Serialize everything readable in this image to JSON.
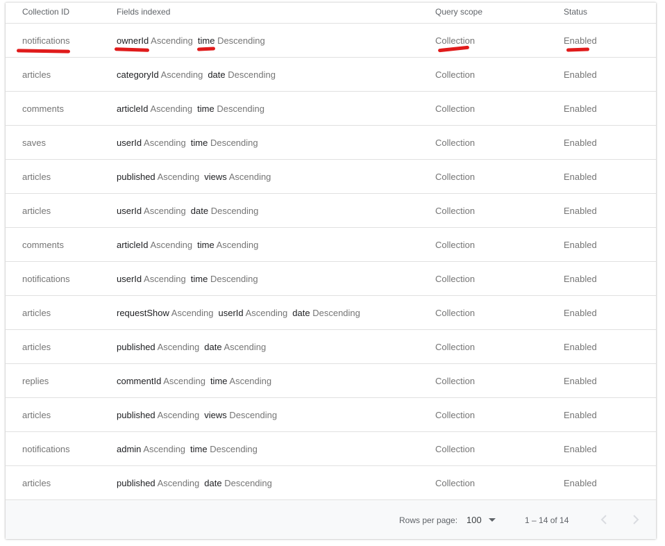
{
  "table": {
    "headers": {
      "collection_id": "Collection ID",
      "fields_indexed": "Fields indexed",
      "query_scope": "Query scope",
      "status": "Status"
    },
    "rows": [
      {
        "collection": "notifications",
        "fields": [
          {
            "name": "ownerId",
            "order": "Ascending"
          },
          {
            "name": "time",
            "order": "Descending"
          }
        ],
        "scope": "Collection",
        "status": "Enabled"
      },
      {
        "collection": "articles",
        "fields": [
          {
            "name": "categoryId",
            "order": "Ascending"
          },
          {
            "name": "date",
            "order": "Descending"
          }
        ],
        "scope": "Collection",
        "status": "Enabled"
      },
      {
        "collection": "comments",
        "fields": [
          {
            "name": "articleId",
            "order": "Ascending"
          },
          {
            "name": "time",
            "order": "Descending"
          }
        ],
        "scope": "Collection",
        "status": "Enabled"
      },
      {
        "collection": "saves",
        "fields": [
          {
            "name": "userId",
            "order": "Ascending"
          },
          {
            "name": "time",
            "order": "Descending"
          }
        ],
        "scope": "Collection",
        "status": "Enabled"
      },
      {
        "collection": "articles",
        "fields": [
          {
            "name": "published",
            "order": "Ascending"
          },
          {
            "name": "views",
            "order": "Ascending"
          }
        ],
        "scope": "Collection",
        "status": "Enabled"
      },
      {
        "collection": "articles",
        "fields": [
          {
            "name": "userId",
            "order": "Ascending"
          },
          {
            "name": "date",
            "order": "Descending"
          }
        ],
        "scope": "Collection",
        "status": "Enabled"
      },
      {
        "collection": "comments",
        "fields": [
          {
            "name": "articleId",
            "order": "Ascending"
          },
          {
            "name": "time",
            "order": "Ascending"
          }
        ],
        "scope": "Collection",
        "status": "Enabled"
      },
      {
        "collection": "notifications",
        "fields": [
          {
            "name": "userId",
            "order": "Ascending"
          },
          {
            "name": "time",
            "order": "Descending"
          }
        ],
        "scope": "Collection",
        "status": "Enabled"
      },
      {
        "collection": "articles",
        "fields": [
          {
            "name": "requestShow",
            "order": "Ascending"
          },
          {
            "name": "userId",
            "order": "Ascending"
          },
          {
            "name": "date",
            "order": "Descending"
          }
        ],
        "scope": "Collection",
        "status": "Enabled"
      },
      {
        "collection": "articles",
        "fields": [
          {
            "name": "published",
            "order": "Ascending"
          },
          {
            "name": "date",
            "order": "Ascending"
          }
        ],
        "scope": "Collection",
        "status": "Enabled"
      },
      {
        "collection": "replies",
        "fields": [
          {
            "name": "commentId",
            "order": "Ascending"
          },
          {
            "name": "time",
            "order": "Ascending"
          }
        ],
        "scope": "Collection",
        "status": "Enabled"
      },
      {
        "collection": "articles",
        "fields": [
          {
            "name": "published",
            "order": "Ascending"
          },
          {
            "name": "views",
            "order": "Descending"
          }
        ],
        "scope": "Collection",
        "status": "Enabled"
      },
      {
        "collection": "notifications",
        "fields": [
          {
            "name": "admin",
            "order": "Ascending"
          },
          {
            "name": "time",
            "order": "Descending"
          }
        ],
        "scope": "Collection",
        "status": "Enabled"
      },
      {
        "collection": "articles",
        "fields": [
          {
            "name": "published",
            "order": "Ascending"
          },
          {
            "name": "date",
            "order": "Descending"
          }
        ],
        "scope": "Collection",
        "status": "Enabled"
      }
    ]
  },
  "footer": {
    "rows_per_page_label": "Rows per page:",
    "rows_per_page_value": "100",
    "range_text": "1 – 14 of  14"
  },
  "icons": {
    "caret": "arrow-drop-down-icon",
    "prev": "chevron-left-icon",
    "next": "chevron-right-icon"
  },
  "colors": {
    "annotation": "#e01b1b",
    "disabled_icon": "#dadce0"
  }
}
